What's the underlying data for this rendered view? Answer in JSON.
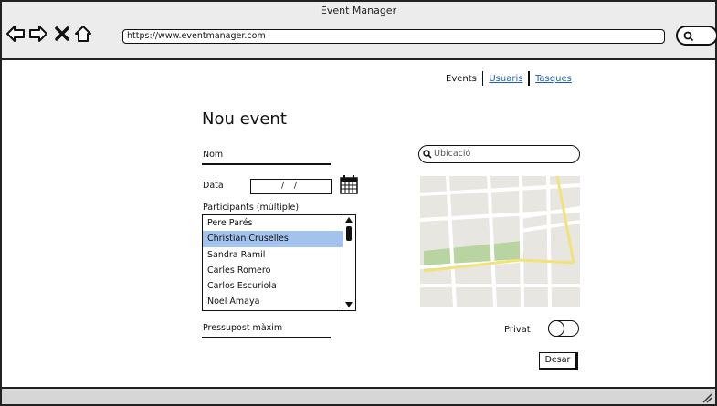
{
  "window": {
    "title": "Event Manager"
  },
  "browser": {
    "url": "https://www.eventmanager.com",
    "icons": [
      "back-arrow-icon",
      "forward-arrow-icon",
      "close-x-icon",
      "home-icon",
      "search-icon"
    ]
  },
  "nav": {
    "events": "Events",
    "users": "Usuaris",
    "tasks": "Tasques"
  },
  "form": {
    "title": "Nou event",
    "name_label": "Nom",
    "date_label": "Data",
    "date_value": "/ /",
    "participants_label": "Participants (múltiple)",
    "participants": [
      {
        "name": "Pere Parés",
        "selected": false
      },
      {
        "name": "Christian Cruselles",
        "selected": true
      },
      {
        "name": "Sandra Ramil",
        "selected": false
      },
      {
        "name": "Carles Romero",
        "selected": false
      },
      {
        "name": "Carlos Escuriola",
        "selected": false
      },
      {
        "name": "Noel Amaya",
        "selected": false
      }
    ],
    "budget_label": "Pressupost màxim",
    "location_placeholder": "Ubicació",
    "private_label": "Privat",
    "private_on": false,
    "save_label": "Desar"
  },
  "colors": {
    "link": "#1a5fb4",
    "selection": "#a4c2ee",
    "map_road_major": "#f3e27a",
    "map_park": "#b8d4a0"
  }
}
